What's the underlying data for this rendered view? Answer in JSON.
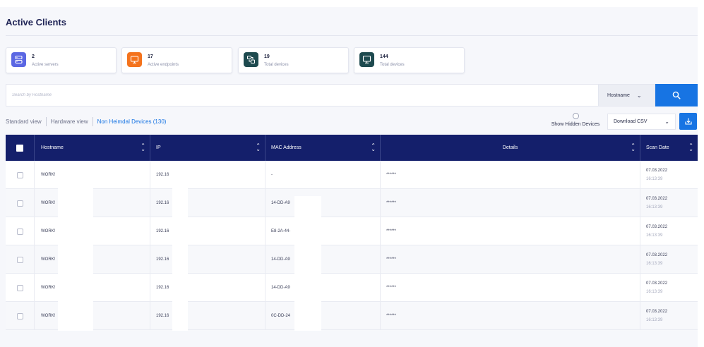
{
  "page": {
    "title": "Active Clients"
  },
  "stats": [
    {
      "value": "2",
      "label": "Active servers",
      "color": "#5b67e3",
      "icon": "server-icon"
    },
    {
      "value": "17",
      "label": "Active endpoints",
      "color": "#f4731d",
      "icon": "monitor-icon"
    },
    {
      "value": "19",
      "label": "Total devices",
      "color": "#1e4a4f",
      "icon": "devices-icon"
    },
    {
      "value": "144",
      "label": "Total devices",
      "color": "#1e4a4f",
      "icon": "desktop-icon"
    }
  ],
  "search": {
    "placeholder": "Search by Hostname",
    "field": "Hostname",
    "button_icon": "search-icon"
  },
  "views": {
    "items": [
      "Standard view",
      "Hardware view",
      "Non Heimdal Devices (130)"
    ],
    "active_index": 2
  },
  "options": {
    "show_hidden": "Show Hidden Devices",
    "download": "Download CSV",
    "download_icon": "download-icon"
  },
  "table": {
    "columns": [
      "Hostname",
      "IP",
      "MAC Address",
      "Details",
      "Scan Date"
    ],
    "rows": [
      {
        "hostname": "WORK!",
        "ip": "192.16",
        "mac": "-",
        "details": "******",
        "date": "07.03.2022",
        "time": "16:13:39"
      },
      {
        "hostname": "WORK!",
        "ip": "192.16",
        "mac": "14-DD-A9",
        "details": "******",
        "date": "07.03.2022",
        "time": "16:13:39"
      },
      {
        "hostname": "WORK!",
        "ip": "192.16       1",
        "mac": "E8-2A-44-",
        "details": "******",
        "date": "07.03.2022",
        "time": "16:13:39"
      },
      {
        "hostname": "WORK!",
        "ip": "192.16",
        "mac": "14-DD-A9",
        "details": "******",
        "date": "07.03.2022",
        "time": "16:13:39"
      },
      {
        "hostname": "WORK!",
        "ip": "192.16",
        "mac": "14-DD-A9",
        "details": "******",
        "date": "07.03.2022",
        "time": "16:13:39"
      },
      {
        "hostname": "WORK!",
        "ip": "192.16",
        "mac": "0C-DD-24",
        "details": "******",
        "date": "07.03.2022",
        "time": "16:13:39"
      }
    ]
  },
  "colors": {
    "accent": "#1774e3",
    "table_header": "#141f6b"
  }
}
